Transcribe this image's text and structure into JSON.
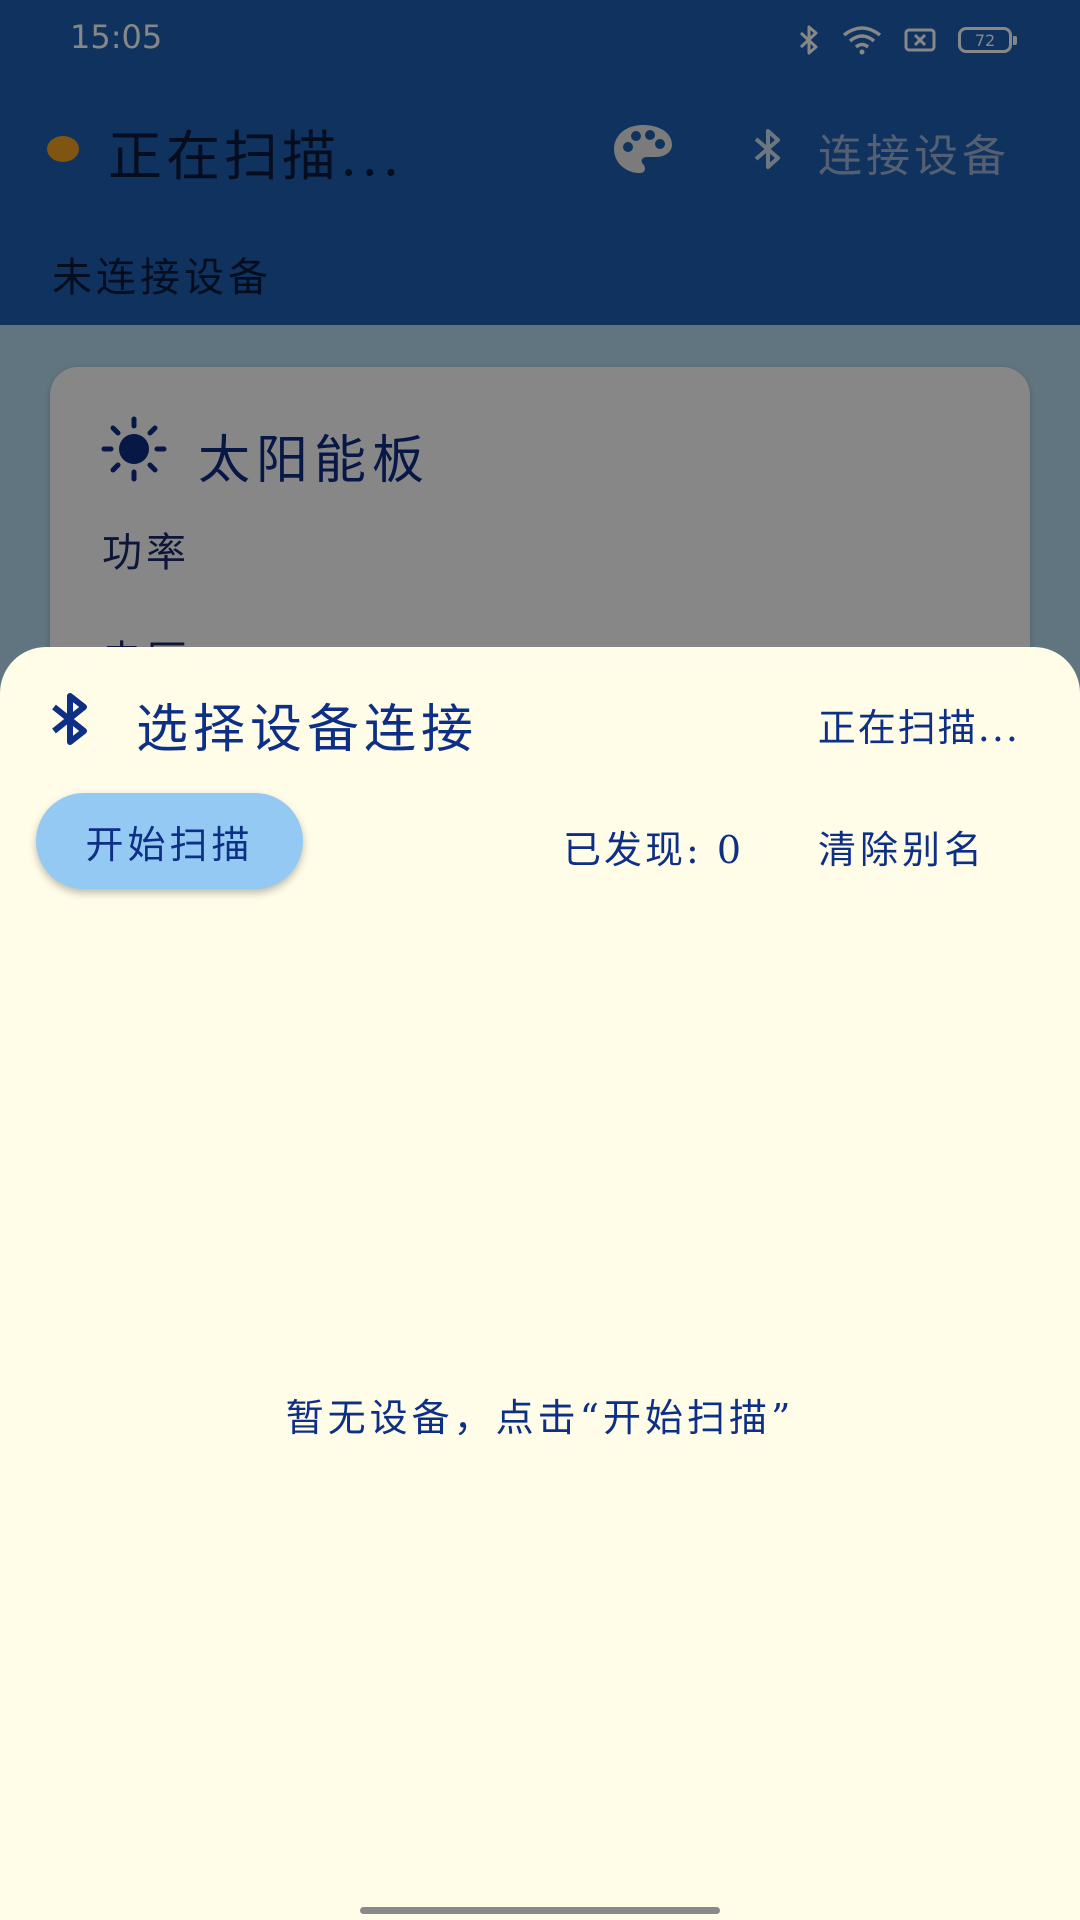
{
  "status_bar": {
    "time": "15:05",
    "battery": "72",
    "icons": [
      "bluetooth-icon",
      "wifi-icon",
      "sim-blocked-icon",
      "battery-icon"
    ]
  },
  "header": {
    "scan_status": "正在扫描...",
    "connect_label": "连接设备",
    "subtitle": "未连接设备",
    "indicator_color": "#f0a020",
    "icons": [
      "palette-icon",
      "bluetooth-icon"
    ]
  },
  "card": {
    "title": "太阳能板",
    "power_label": "功率",
    "voltage_label": "电压",
    "icon": "sun-icon"
  },
  "sheet": {
    "title": "选择设备连接",
    "status": "正在扫描...",
    "scan_button": "开始扫描",
    "found": "已发现: 0",
    "clear_alias": "清除别名",
    "empty_hint": "暂无设备，点击“开始扫描”",
    "icon": "bluetooth-icon"
  },
  "colors": {
    "header_bg": "#1e5fb3",
    "sheet_bg": "#fffce8",
    "accent_text": "#0e2f86",
    "scan_button_bg": "#93c9f2"
  }
}
